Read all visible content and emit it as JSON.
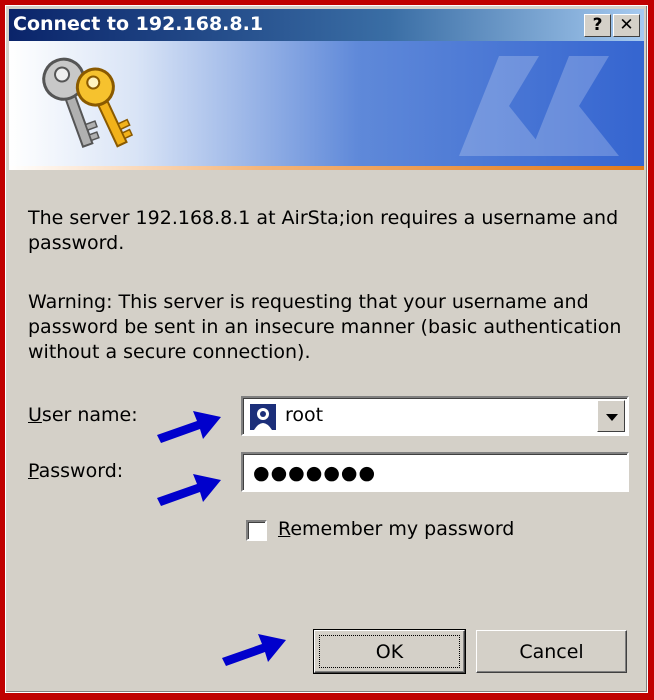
{
  "window": {
    "title": "Connect to 192.168.8.1",
    "help_label": "?",
    "close_label": "✕"
  },
  "message": {
    "text": "The server 192.168.8.1 at AirSta;ion requires a username and password.",
    "warning": "Warning: This server is requesting that your username and password be sent in an insecure manner (basic authentication without a secure connection)."
  },
  "form": {
    "username_label_prefix": "U",
    "username_label_rest": "ser name:",
    "username_value": "root",
    "password_label_prefix": "P",
    "password_label_rest": "assword:",
    "password_value": "●●●●●●●",
    "remember_prefix": "R",
    "remember_rest": "emember my password",
    "remember_checked": false
  },
  "buttons": {
    "ok_label": "OK",
    "cancel_label": "Cancel"
  },
  "colors": {
    "background": "#c00000",
    "annotation_arrow": "#0000cc",
    "titlebar_start": "#0a246a",
    "dialog_face": "#d4d0c8"
  },
  "icons": {
    "banner_icon": "keys-icon",
    "user_icon": "user-icon",
    "annotation": "arrow-icon"
  }
}
